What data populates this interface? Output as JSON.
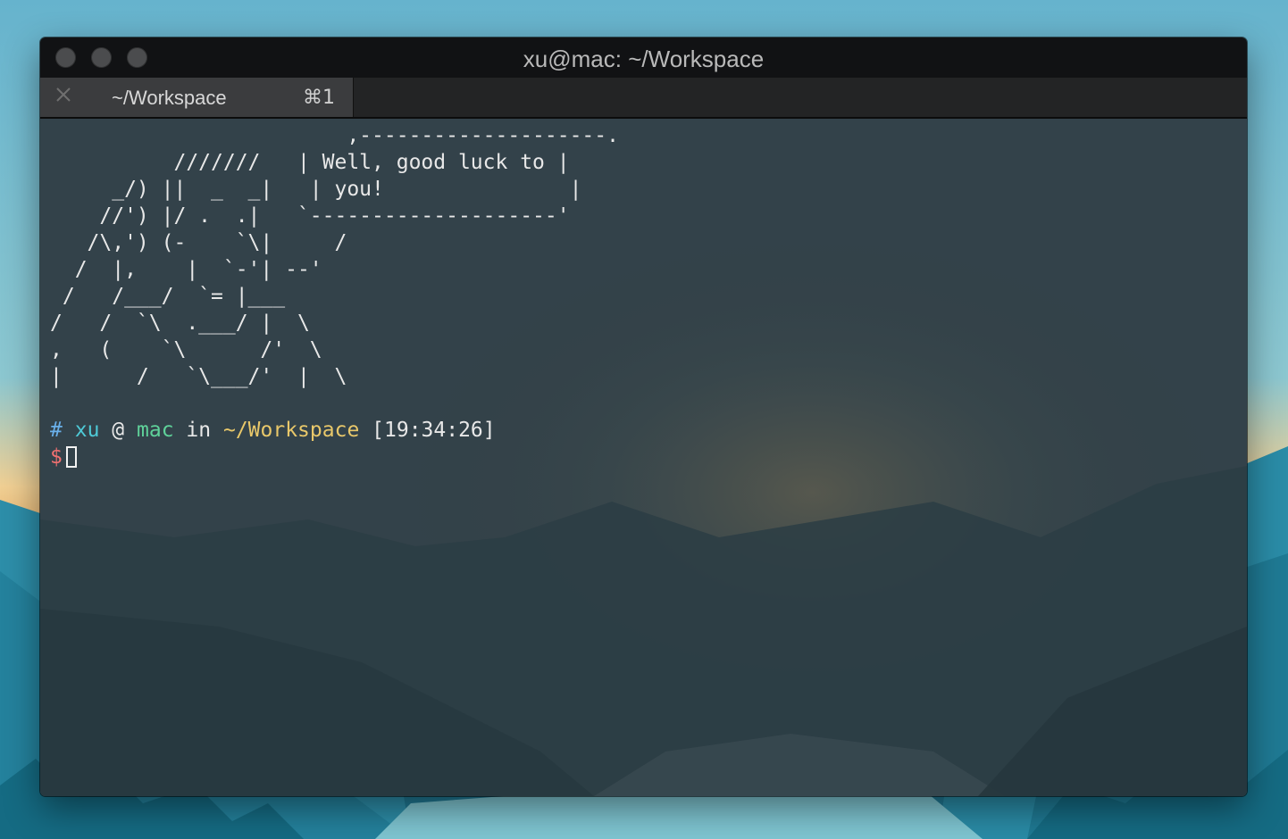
{
  "window": {
    "title": "xu@mac: ~/Workspace"
  },
  "tab": {
    "title": "~/Workspace",
    "shortcut": "⌘1"
  },
  "terminal": {
    "ascii_art": "                        ,--------------------.\n          ///////   | Well, good luck to |\n     _/) ||  _  _|   | you!               |\n    //') |/ .  .|   `--------------------'\n   /\\,') (-    `\\|     /\n  /  |,    |  `-'| --'\n /   /___/  `= |___\n/   /  `\\  .___/ |  \\\n,   (    `\\      /'  \\\n|      /   `\\___/'  |  \\",
    "prompt": {
      "hash": "#",
      "user": "xu",
      "at": "@",
      "host": "mac",
      "in": "in",
      "path": "~/Workspace",
      "time": "[19:34:26]",
      "dollar": "$"
    }
  },
  "colors": {
    "hash": "#6ab0ea",
    "user": "#4ec9d6",
    "host": "#5fd29a",
    "path": "#e9c86a",
    "dollar": "#f07070"
  }
}
